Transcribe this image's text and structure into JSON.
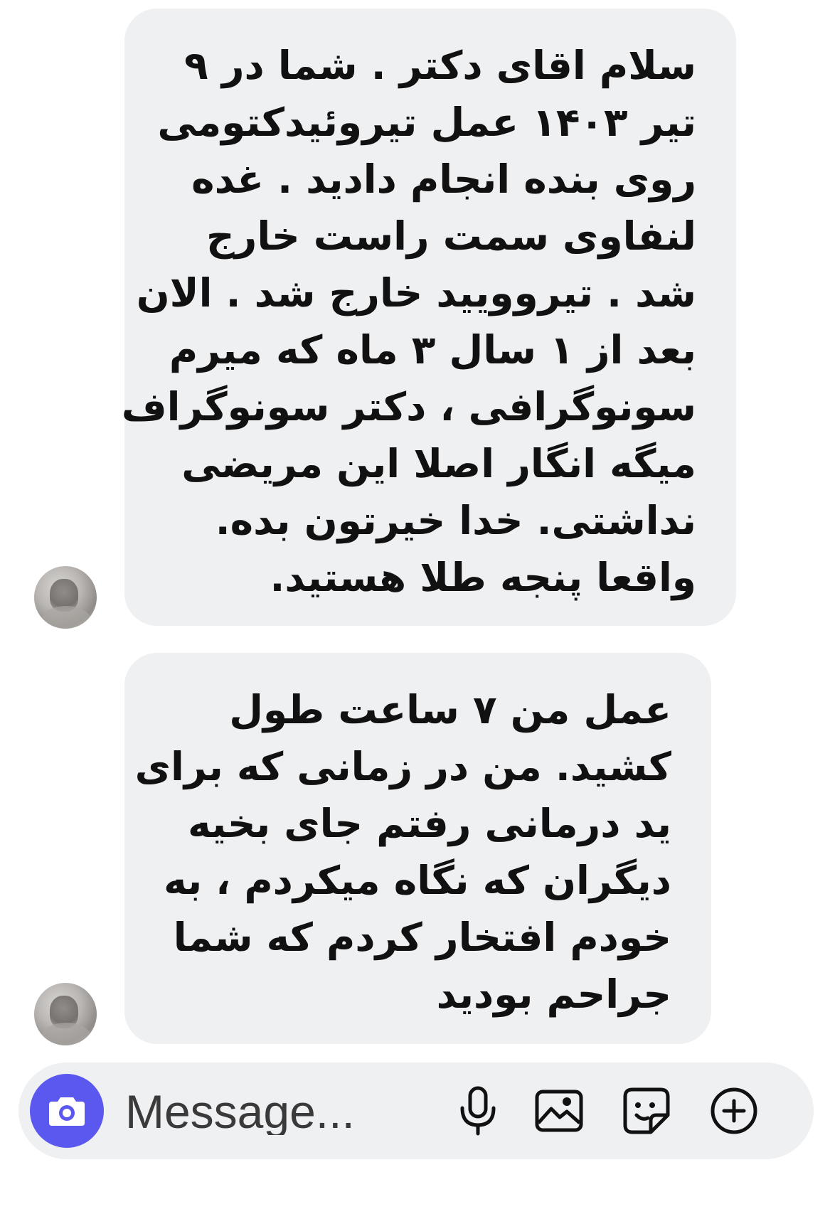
{
  "messages": [
    {
      "lines": [
        "سلام اقای دکتر . شما در ۹",
        "تیر ۱۴۰۳ عمل تیروئیدکتومی",
        "روی بنده انجام دادید . غده",
        "لنفاوی سمت راست خارج",
        "شد . تیروویید خارج شد . الان",
        "بعد از ۱ سال ۳ ماه که میرم",
        "سونوگرافی ، دکتر سونوگراف",
        "میگه انگار اصلا این مریضی",
        "نداشتی. خدا خیرتون بده.",
        "واقعا پنجه طلا هستید."
      ]
    },
    {
      "lines": [
        "عمل من ۷ ساعت طول",
        "کشید. من در زمانی که برای",
        "ید درمانی رفتم جای بخیه",
        "دیگران که نگاه میکردم ، به",
        "خودم افتخار کردم که شما",
        "جراحم بودید"
      ]
    }
  ],
  "composer": {
    "placeholder": "Message...",
    "camera_icon": "camera-icon",
    "mic_icon": "microphone-icon",
    "gallery_icon": "image-icon",
    "sticker_icon": "sticker-icon",
    "plus_icon": "plus-circle-icon",
    "accent_color": "#5b58f0"
  }
}
